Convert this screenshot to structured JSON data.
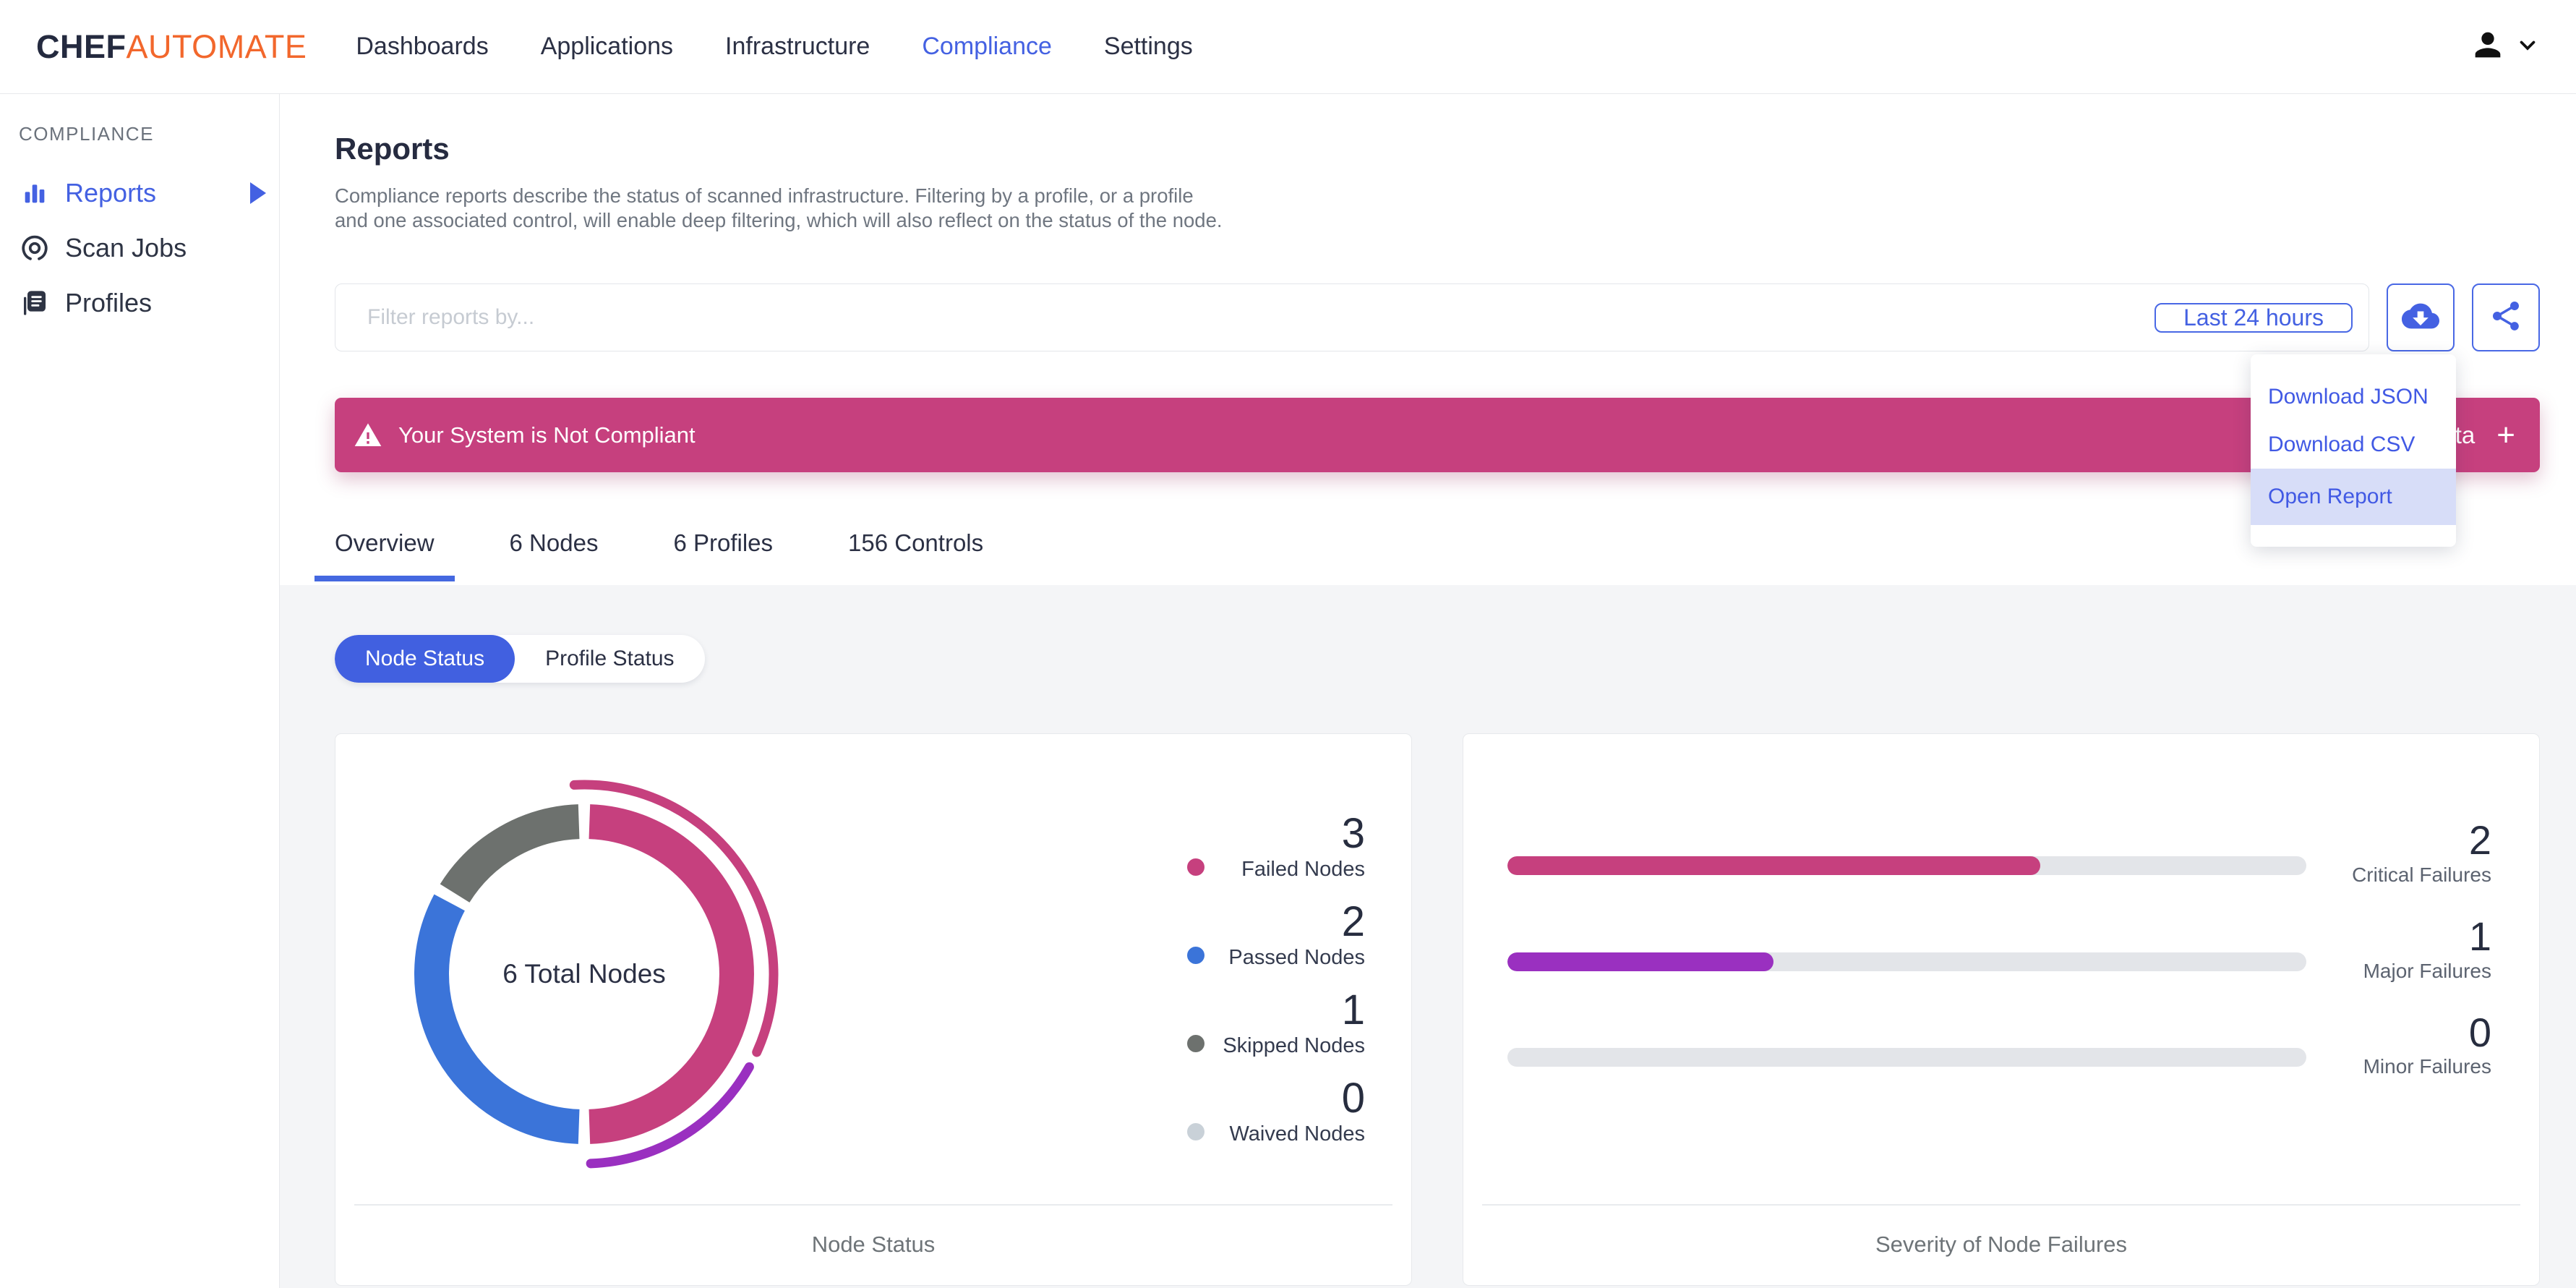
{
  "header": {
    "logo": {
      "chef": "CHEF",
      "automate": "AUTOMATE"
    },
    "nav": [
      {
        "label": "Dashboards",
        "active": false
      },
      {
        "label": "Applications",
        "active": false
      },
      {
        "label": "Infrastructure",
        "active": false
      },
      {
        "label": "Compliance",
        "active": true
      },
      {
        "label": "Settings",
        "active": false
      }
    ]
  },
  "sidebar": {
    "section_label": "COMPLIANCE",
    "items": [
      {
        "label": "Reports",
        "icon": "bar-chart-icon",
        "active": true,
        "has_submenu": true
      },
      {
        "label": "Scan Jobs",
        "icon": "scan-target-icon",
        "active": false,
        "has_submenu": false
      },
      {
        "label": "Profiles",
        "icon": "profiles-icon",
        "active": false,
        "has_submenu": false
      }
    ]
  },
  "page": {
    "title": "Reports",
    "description": "Compliance reports describe the status of scanned infrastructure. Filtering by a profile, or a profile and one associated control, will enable deep filtering, which will also reflect on the status of the node."
  },
  "filter": {
    "placeholder": "Filter reports by...",
    "time_range_label": "Last 24 hours"
  },
  "banner": {
    "text": "Your System is Not Compliant",
    "partial_right_text": "ta",
    "plus_label": "+"
  },
  "download_menu": {
    "items": [
      {
        "label": "Download JSON",
        "highlighted": false
      },
      {
        "label": "Download CSV",
        "highlighted": false
      },
      {
        "label": "Open Report",
        "highlighted": true
      }
    ]
  },
  "tabs": [
    {
      "label": "Overview",
      "active": true
    },
    {
      "label": "6 Nodes",
      "active": false
    },
    {
      "label": "6 Profiles",
      "active": false
    },
    {
      "label": "156 Controls",
      "active": false
    }
  ],
  "status_toggle": [
    {
      "label": "Node Status",
      "active": true
    },
    {
      "label": "Profile Status",
      "active": false
    }
  ],
  "colors": {
    "accent_blue": "#4461e2",
    "failed_pink": "#c6407e",
    "passed_blue": "#3b74d9",
    "skipped_gray": "#6d716e",
    "waived_gray": "#c9d1d8",
    "major_purple": "#9a30c0",
    "track_gray": "#e3e5e9"
  },
  "chart_data": [
    {
      "type": "pie",
      "variant": "donut",
      "title": "Node Status",
      "center_label": "6 Total Nodes",
      "total": 6,
      "segments": [
        {
          "label": "Failed Nodes",
          "value": 3,
          "color": "#c6407e"
        },
        {
          "label": "Passed Nodes",
          "value": 2,
          "color": "#3b74d9"
        },
        {
          "label": "Skipped Nodes",
          "value": 1,
          "color": "#6d716e"
        },
        {
          "label": "Waived Nodes",
          "value": 0,
          "color": "#c9d1d8"
        }
      ],
      "outer_severity_arcs": [
        {
          "label": "Critical",
          "value": 2,
          "color": "#c6407e"
        },
        {
          "label": "Major",
          "value": 1,
          "color": "#9a30c0"
        }
      ],
      "legend_position": "right"
    },
    {
      "type": "bar",
      "variant": "horizontal-progress",
      "title": "Severity of Node Failures",
      "max_total": 3,
      "bars": [
        {
          "label": "Critical Failures",
          "value": 2,
          "color": "#c6407e"
        },
        {
          "label": "Major Failures",
          "value": 1,
          "color": "#9a30c0"
        },
        {
          "label": "Minor Failures",
          "value": 0,
          "color": "#e3e5e9"
        }
      ]
    }
  ]
}
